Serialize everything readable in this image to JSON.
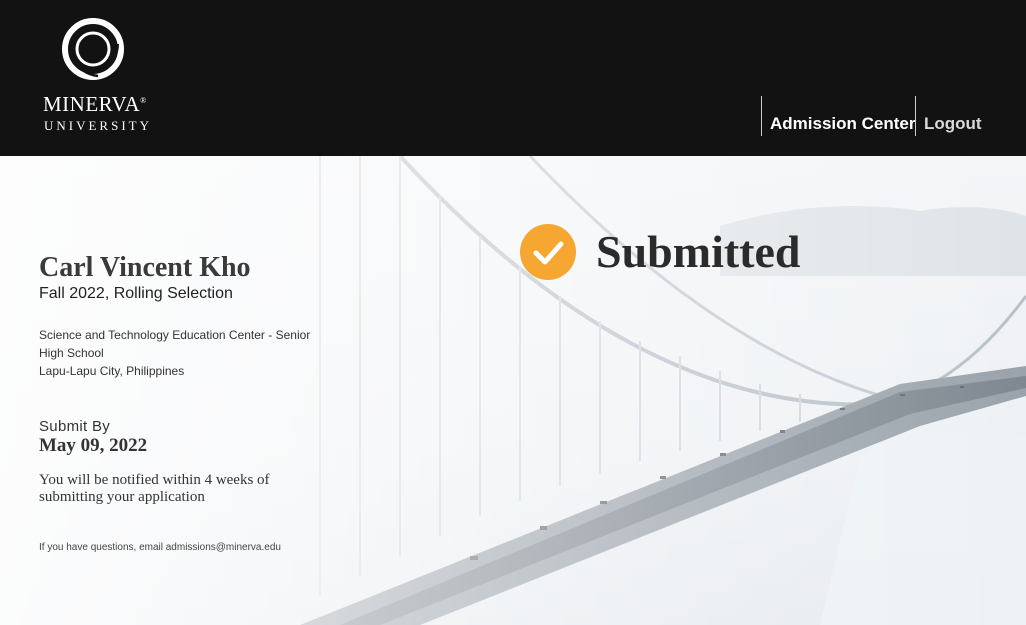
{
  "brand": {
    "name": "MINERVA",
    "mark": "®",
    "subtitle": "UNIVERSITY"
  },
  "nav": {
    "admission_center": "Admission Center",
    "logout": "Logout"
  },
  "status": {
    "label": "Submitted",
    "icon": "checkmark-circle-icon",
    "color": "#f5a731"
  },
  "applicant": {
    "name": "Carl Vincent Kho",
    "term": "Fall 2022, Rolling Selection",
    "school": "Science and Technology Education Center - Senior High School",
    "location": "Lapu-Lapu City, Philippines"
  },
  "deadline": {
    "label": "Submit By",
    "date": "May 09, 2022",
    "note": "You will be notified within 4 weeks of submitting your application"
  },
  "contact": {
    "text": "If you have questions, email admissions@minerva.edu"
  }
}
